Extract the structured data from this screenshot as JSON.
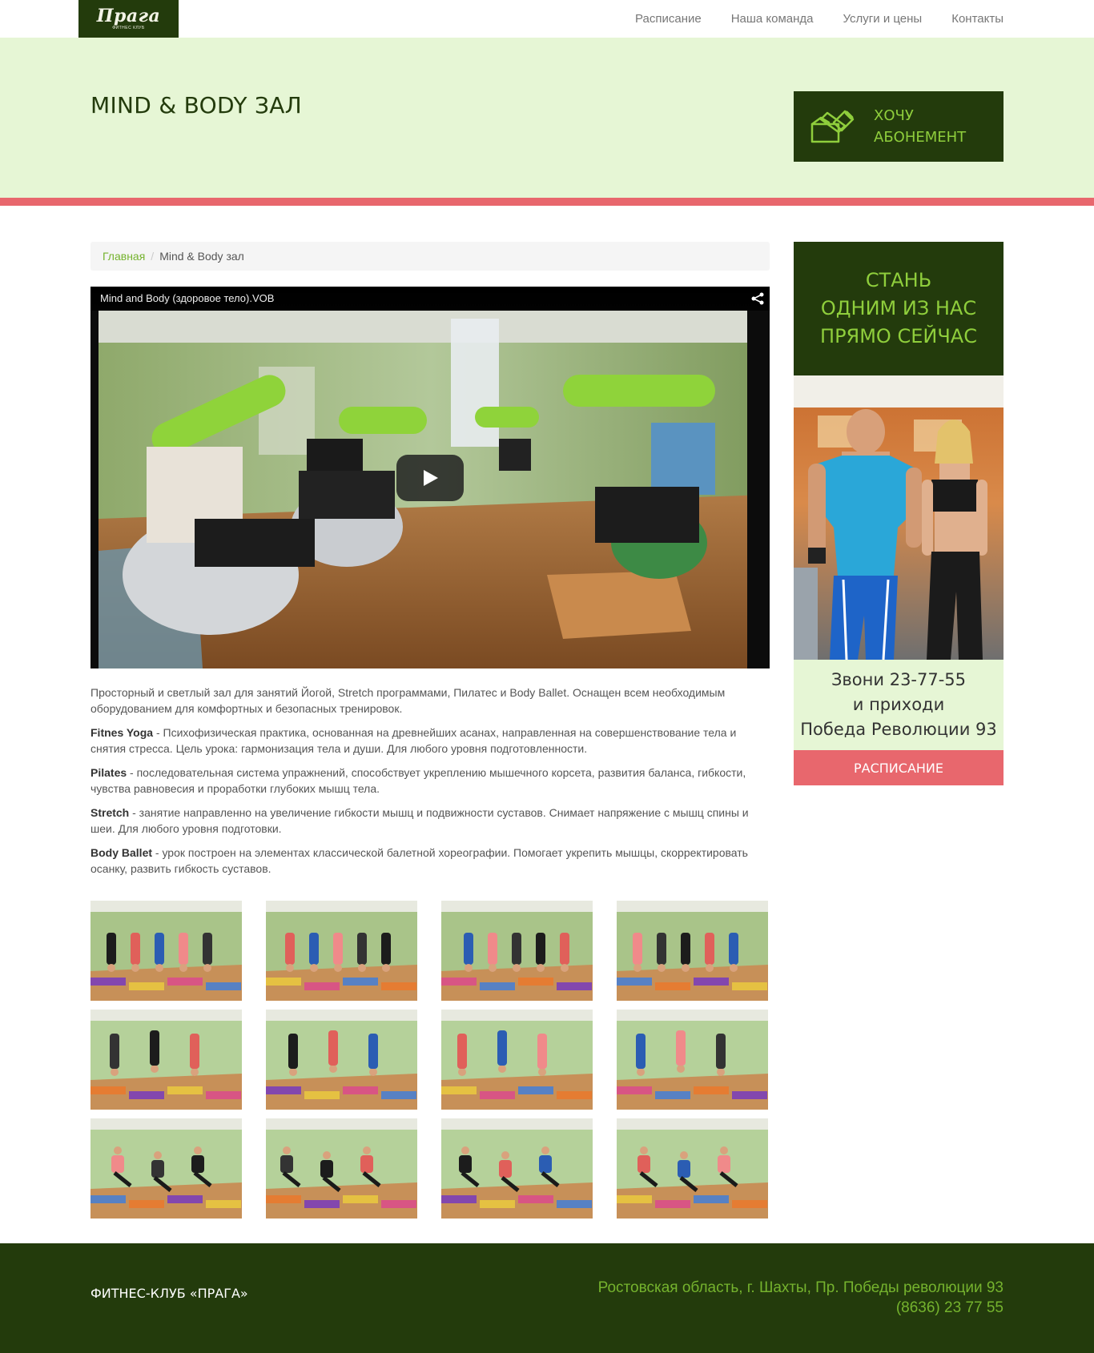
{
  "header": {
    "logo_text": "Прага",
    "logo_sub": "ФИТНЕС КЛУБ",
    "nav": [
      {
        "label": "Расписание"
      },
      {
        "label": "Наша команда"
      },
      {
        "label": "Услуги и цены"
      },
      {
        "label": "Контакты"
      }
    ]
  },
  "hero": {
    "title": "MIND & BODY ЗАЛ",
    "cta_line1": "Хочу",
    "cta_line2": "абонемент",
    "cta_icon": "ticket-pen-icon",
    "colors": {
      "dark": "#233b0c",
      "accent": "#8fce3c",
      "bg": "#e6f6d5",
      "stripe": "#e8676d"
    }
  },
  "breadcrumb": {
    "home": "Главная",
    "separator": "/",
    "current": "Mind & Body зал"
  },
  "video": {
    "title": "Mind and Body (здоровое тело).VOB",
    "share_icon": "share-icon",
    "play_icon": "play-icon"
  },
  "content": {
    "intro": "Просторный и светлый зал для занятий Йогой, Stretch программами, Пилатес и Body Ballet. Оснащен всем необходимым оборудованием для комфортных и безопасных тренировок.",
    "items": [
      {
        "name": "Fitnes Yoga",
        "text": " - Психофизическая практика, основанная на древнейших асанах, направленная на совершенствование тела и снятия стресса. Цель урока: гармонизация тела и души. Для любого уровня подготовленности."
      },
      {
        "name": "Pilates",
        "text": " - последовательная система упражнений, способствует укреплению мышечного корсета, развития баланса, гибкости, чувства равновесия и проработки глубоких мышц тела."
      },
      {
        "name": "Stretch",
        "text": " - занятие направленно на увеличение гибкости мышц и подвижности суставов. Снимает напряжение с мышц спины и шеи. Для любого уровня подготовки."
      },
      {
        "name": "Body Ballet",
        "text": " - урок построен на элементах классической балетной хореографии. Помогает укрепить мышцы, скорректировать осанку, развить гибкость суставов."
      }
    ]
  },
  "gallery": {
    "count": 12
  },
  "sidebar": {
    "banner": "Стань\nодним из нас\nпрямо сейчас",
    "phone_line": "Звони 23-77-55",
    "line2": "и приходи",
    "address_line": "Победа Революции 93",
    "button": "Расписание"
  },
  "footer": {
    "brand": "Фитнес-клуб «Прага»",
    "address": "Ростовская область, г. Шахты, Пр. Победы революции 93",
    "phone": "(8636) 23 77 55"
  }
}
